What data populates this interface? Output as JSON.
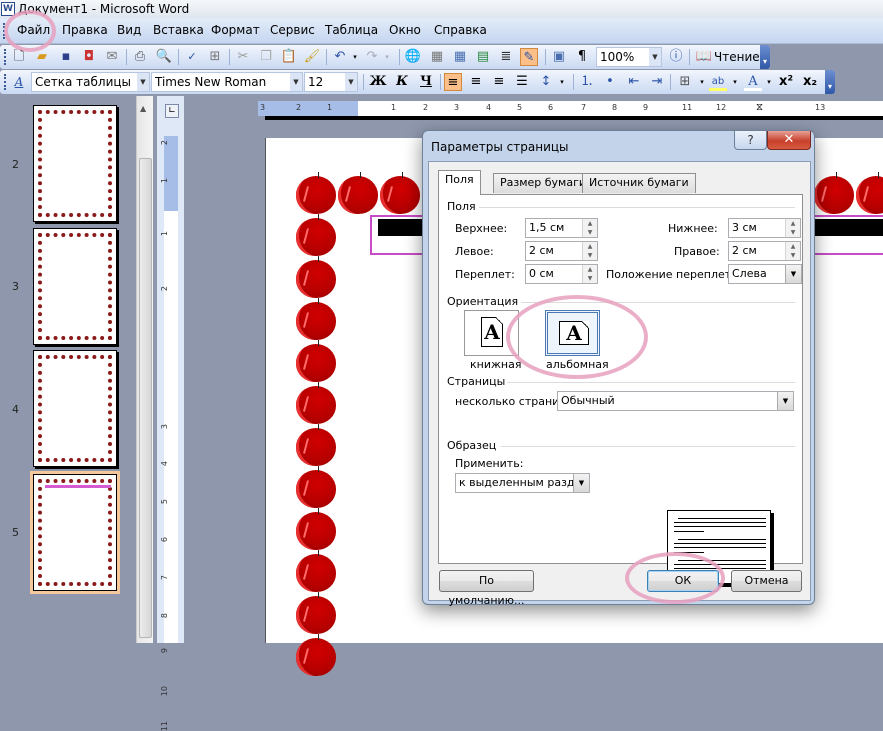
{
  "window": {
    "title": "Документ1 - Microsoft Word",
    "app_icon": "word-doc-icon"
  },
  "menu": {
    "items": [
      {
        "label": "Файл",
        "underline": "Ф"
      },
      {
        "label": "Правка",
        "underline": "П"
      },
      {
        "label": "Вид",
        "underline": "В"
      },
      {
        "label": "Вставка",
        "underline": "а"
      },
      {
        "label": "Формат",
        "underline": "м"
      },
      {
        "label": "Сервис",
        "underline": "е"
      },
      {
        "label": "Таблица",
        "underline": "Т"
      },
      {
        "label": "Окно",
        "underline": "О"
      },
      {
        "label": "Справка",
        "underline": "С"
      }
    ]
  },
  "standard_toolbar": {
    "icons": [
      "new-document-icon",
      "open-folder-icon",
      "save-icon",
      "permission-icon",
      "email-icon",
      "print-icon",
      "print-preview-icon",
      "spelling-icon",
      "research-icon",
      "cut-icon",
      "copy-icon",
      "paste-icon",
      "format-painter-icon",
      "undo-icon",
      "redo-icon",
      "hyperlink-icon",
      "tables-borders-icon",
      "insert-table-icon",
      "insert-excel-icon",
      "columns-icon",
      "drawing-icon",
      "document-map-icon",
      "show-formatting-icon",
      "help-icon",
      "read-icon"
    ],
    "zoom": "100%",
    "read_label": "Чтение"
  },
  "formatting_toolbar": {
    "style": "Сетка таблицы",
    "font": "Times New Roman",
    "size": "12",
    "bold": "Ж",
    "italic": "К",
    "underline": "Ч",
    "pilcrow": "¶",
    "font_color_letter": "A",
    "highlight_label": "ab",
    "superscript": "x²",
    "subscript": "x₂"
  },
  "thumbnails": {
    "pages": [
      {
        "number": "2",
        "selected": false
      },
      {
        "number": "3",
        "selected": false
      },
      {
        "number": "4",
        "selected": false
      },
      {
        "number": "5",
        "selected": true
      }
    ]
  },
  "hruler": {
    "ticks": [
      "3",
      "2",
      "1",
      "1",
      "2",
      "3",
      "4",
      "5",
      "6",
      "7",
      "8",
      "9",
      "11",
      "12",
      "13"
    ]
  },
  "vruler": {
    "ticks": [
      "2",
      "1",
      "1",
      "2",
      "3",
      "4",
      "5",
      "6",
      "7",
      "8",
      "9",
      "10",
      "11"
    ]
  },
  "dialog": {
    "title": "Параметры страницы",
    "help": "?",
    "close": "✕",
    "tabs": [
      {
        "label": "Поля",
        "active": true
      },
      {
        "label": "Размер бумаги",
        "active": false
      },
      {
        "label": "Источник бумаги",
        "active": false
      }
    ],
    "margins": {
      "group": "Поля",
      "top_label": "Верхнее:",
      "top_value": "1,5 см",
      "bottom_label": "Нижнее:",
      "bottom_value": "3 см",
      "left_label": "Левое:",
      "left_value": "2 см",
      "right_label": "Правое:",
      "right_value": "2 см",
      "gutter_label": "Переплет:",
      "gutter_value": "0 см",
      "gutter_pos_label": "Положение переплета:",
      "gutter_pos_value": "Слева"
    },
    "orientation": {
      "group": "Ориентация",
      "portrait": "книжная",
      "landscape": "альбомная",
      "selected": "альбомная",
      "glyph": "A"
    },
    "pages": {
      "group": "Страницы",
      "multiple_label": "несколько страниц:",
      "multiple_value": "Обычный"
    },
    "preview": {
      "group": "Образец",
      "apply_label": "Применить:",
      "apply_value": "к выделенным разделам"
    },
    "buttons": {
      "default": "По умолчанию...",
      "ok": "ОК",
      "cancel": "Отмена"
    }
  },
  "colors": {
    "highlight_ring": "#e8a0be",
    "apple_red": "#c00000",
    "header_border": "#c64dc6",
    "close_red": "#c7402c"
  }
}
